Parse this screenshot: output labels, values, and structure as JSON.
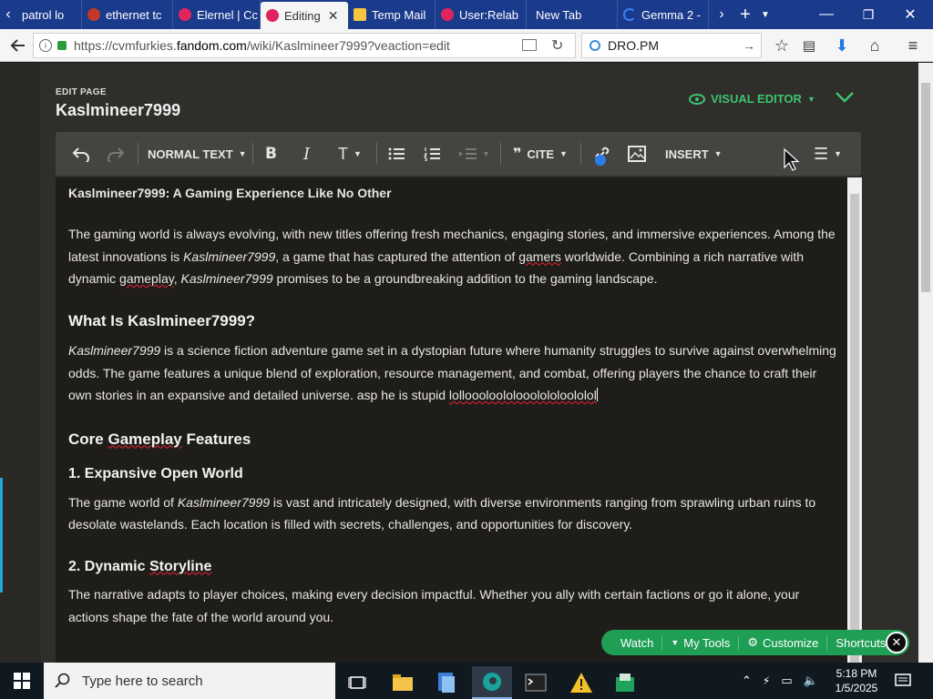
{
  "browser": {
    "tabs": [
      {
        "title": "patrol lo",
        "fav": "#ffffff",
        "active": false
      },
      {
        "title": "ethernet tc",
        "fav": "#c0392b",
        "active": false
      },
      {
        "title": "Elernel | Cc",
        "fav": "#e0245e",
        "active": false
      },
      {
        "title": "Editing",
        "fav": "#e0245e",
        "active": true
      },
      {
        "title": "Temp Mail",
        "fav": "#f5c542",
        "active": false
      },
      {
        "title": "User:Relab",
        "fav": "#e0245e",
        "active": false
      },
      {
        "title": "New Tab",
        "fav": "",
        "active": false
      },
      {
        "title": "Gemma 2 -",
        "fav": "#3b82f6",
        "active": false
      }
    ],
    "url": {
      "prefix": "https://cvmfurkies.",
      "domain": "fandom.com",
      "path": "/wiki/Kaslmineer7999?veaction=edit"
    },
    "search_value": "DRO.PM"
  },
  "edit_header": {
    "label": "EDIT PAGE",
    "title": "Kaslmineer7999",
    "visual_editor": "VISUAL EDITOR"
  },
  "toolbar": {
    "format": "NORMAL TEXT",
    "cite": "CITE",
    "insert": "INSERT"
  },
  "article": {
    "heading_bold": "Kaslmineer7999: A Gaming Experience Like No Other",
    "intro": {
      "a": "The gaming world is always evolving, with new titles offering fresh mechanics, engaging stories, and immersive experiences. Among the latest innovations is ",
      "name1": "Kaslmineer7999",
      "b": ", a game that has captured the attention of ",
      "gamers": "gamers",
      "c": " worldwide. Combining a rich narrative with dynamic ",
      "gameplay": "gameplay",
      "d": ", ",
      "name2": "Kaslmineer7999",
      "e": " promises to be a groundbreaking addition to the gaming landscape."
    },
    "h_what": "What Is Kaslmineer7999?",
    "what": {
      "name": "Kaslmineer7999",
      "a": " is a science fiction adventure game set in a dystopian future where humanity struggles to survive against overwhelming odds. The game features a unique blend of exploration, resource management, and combat, offering players the chance to craft their own stories in an expansive and detailed universe. asp he is stupid ",
      "lol": "lolloooloololooolololoololol"
    },
    "h_core_a": "Core ",
    "h_core_b": "Gameplay",
    "h_core_c": " Features",
    "h_open": "1. Expansive Open World",
    "open": {
      "a": "The game world of ",
      "name": "Kaslmineer7999",
      "b": " is vast and intricately designed, with diverse environments ranging from sprawling urban ruins to desolate wastelands. Each location is filled with secrets, challenges, and opportunities for discovery."
    },
    "h_story_a": "2. Dynamic ",
    "h_story_b": "Storyline",
    "story": "The narrative adapts to player choices, making every decision impactful. Whether you ally with certain factions or go it alone, your actions shape the fate of the world around you."
  },
  "wikibar": {
    "watch": "Watch",
    "mytools": "My Tools",
    "customize": "Customize",
    "shortcuts": "Shortcuts"
  },
  "taskbar": {
    "search_placeholder": "Type here to search",
    "time": "5:18 PM",
    "date": "1/5/2025"
  },
  "colors": {
    "accent": "#3ec46d",
    "tabstrip": "#1a3a8c",
    "wikibar": "#1f9e56"
  }
}
